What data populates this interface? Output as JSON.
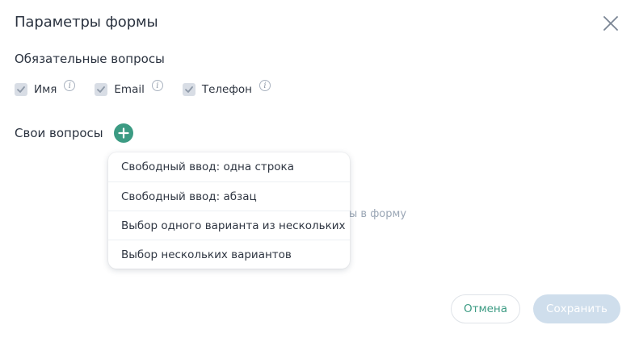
{
  "dialog": {
    "title": "Параметры формы",
    "close_icon": "close-icon"
  },
  "required": {
    "title": "Обязательные вопросы",
    "items": [
      {
        "label": "Имя",
        "checked": true
      },
      {
        "label": "Email",
        "checked": true
      },
      {
        "label": "Телефон",
        "checked": true
      }
    ],
    "info_glyph": "i"
  },
  "custom": {
    "title": "Свои вопросы",
    "add_icon": "plus-icon",
    "hint_partial": "ы в форму"
  },
  "dropdown": {
    "options": [
      "Свободный ввод: одна строка",
      "Свободный ввод: абзац",
      "Выбор одного варианта из нескольких",
      "Выбор нескольких вариантов"
    ]
  },
  "footer": {
    "cancel_label": "Отмена",
    "save_label": "Сохранить"
  },
  "colors": {
    "accent": "#3c9b83",
    "save_disabled_bg": "#cfdeec",
    "checkbox_bg": "#d8dde5"
  }
}
